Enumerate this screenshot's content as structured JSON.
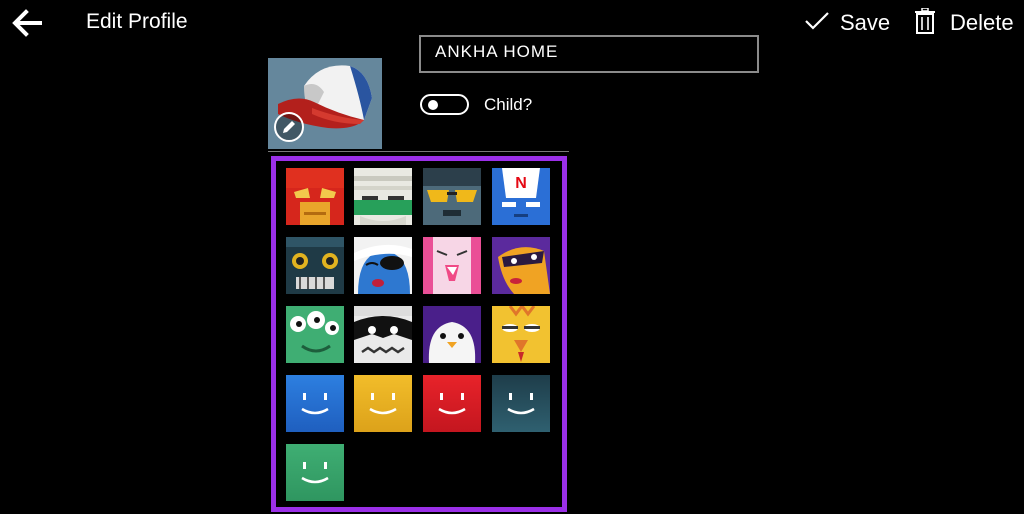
{
  "header": {
    "title": "Edit Profile",
    "save_label": "Save",
    "delete_label": "Delete"
  },
  "profile": {
    "name_value": "ANKHA HOME",
    "child_label": "Child?",
    "child_enabled": false
  },
  "avatar_picker": {
    "highlight_color": "#9b30e8",
    "rows": [
      [
        "red-hero-avatar",
        "bandaged-green-avatar",
        "sunglasses-avatar",
        "netflix-blue-avatar"
      ],
      [
        "robot-speaker-avatar",
        "eyepatch-blue-avatar",
        "pink-monster-avatar",
        "masked-purple-avatar"
      ],
      [
        "green-alien-avatar",
        "raccoon-avatar",
        "penguin-avatar",
        "yellow-bird-avatar"
      ],
      [
        "smile-blue-avatar",
        "smile-yellow-avatar",
        "smile-red-avatar",
        "smile-teal-avatar"
      ],
      [
        "smile-green-avatar"
      ]
    ]
  }
}
